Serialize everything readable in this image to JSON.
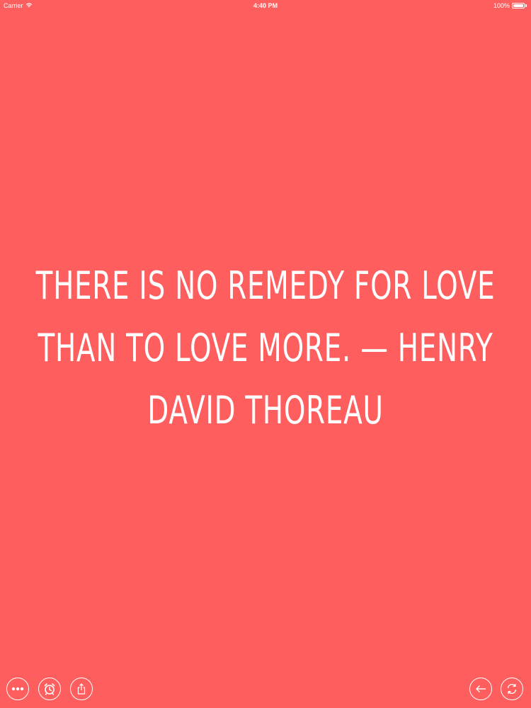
{
  "status_bar": {
    "carrier": "Carrier",
    "time": "4:40 PM",
    "battery_label": "100%",
    "battery_level": 1.0
  },
  "quote": {
    "text": "There is no remedy for love than to love more. — Henry David Thoreau"
  },
  "toolbar": {
    "left_icons": [
      "more-icon",
      "alarm-icon",
      "share-icon"
    ],
    "right_icons": [
      "back-arrow-icon",
      "refresh-icon"
    ]
  },
  "colors": {
    "background": "#ff5e5f",
    "foreground": "#ffffff"
  }
}
